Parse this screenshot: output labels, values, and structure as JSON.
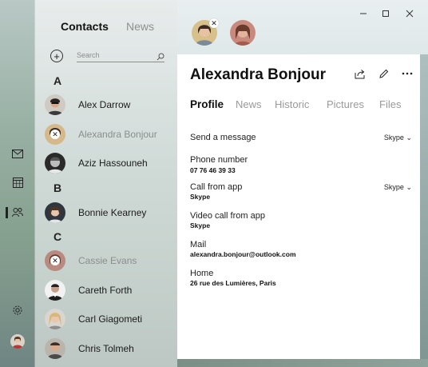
{
  "nav_tabs": {
    "contacts": "Contacts",
    "news": "News"
  },
  "search": {
    "placeholder": "Search"
  },
  "sections": {
    "a": "A",
    "b": "B",
    "c": "C"
  },
  "contacts": [
    {
      "name": "Alex Darrow",
      "pinned": false
    },
    {
      "name": "Alexandra Bonjour",
      "pinned": true
    },
    {
      "name": "Aziz Hassouneh",
      "pinned": false
    },
    {
      "name": "Bonnie Kearney",
      "pinned": false
    },
    {
      "name": "Cassie Evans",
      "pinned": true
    },
    {
      "name": "Careth Forth",
      "pinned": false
    },
    {
      "name": "Carl Giagometi",
      "pinned": false
    },
    {
      "name": "Chris Tolmeh",
      "pinned": false
    }
  ],
  "detail": {
    "name": "Alexandra Bonjour",
    "tabs": [
      "Profile",
      "News",
      "Historic",
      "Pictures",
      "Files"
    ],
    "fields": [
      {
        "label": "Send a message",
        "value": "",
        "dropdown": "Skype"
      },
      {
        "label": "Phone number",
        "value": "07 76 46 39 33",
        "dropdown": ""
      },
      {
        "label": "Call from app",
        "value": "Skype",
        "dropdown": "Skype"
      },
      {
        "label": "Video call from app",
        "value": "Skype",
        "dropdown": ""
      },
      {
        "label": "Mail",
        "value": "alexandra.bonjour@outlook.com",
        "dropdown": ""
      },
      {
        "label": "Home",
        "value": "26 rue des Lumières, Paris",
        "dropdown": ""
      }
    ]
  },
  "icons": {
    "window_controls": [
      "minimize-icon",
      "maximize-icon",
      "close-icon"
    ],
    "rail": [
      "mail-icon",
      "calendar-icon",
      "people-icon",
      "settings-icon",
      "avatar"
    ],
    "card_actions": [
      "share-icon",
      "edit-icon",
      "more-icon"
    ]
  },
  "colors": {
    "accent_text": "#111111",
    "inactive_tab": "#9a9a9a"
  }
}
